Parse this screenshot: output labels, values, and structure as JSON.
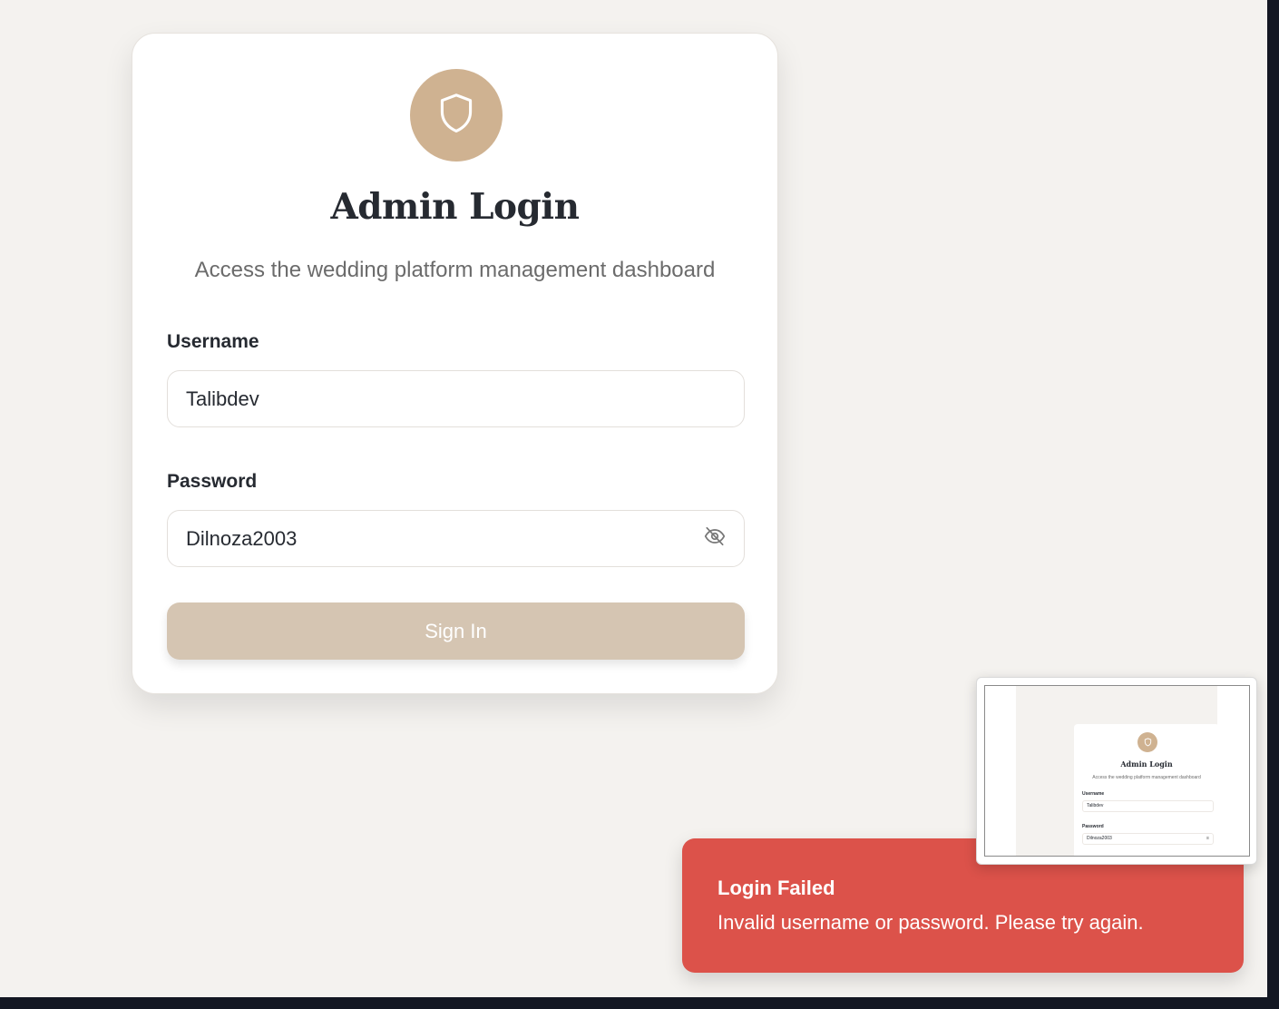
{
  "login": {
    "title": "Admin Login",
    "subtitle": "Access the wedding platform management dashboard",
    "username_label": "Username",
    "username_value": "Talibdev",
    "password_label": "Password",
    "password_value": "Dilnoza2003",
    "signin_label": "Sign In",
    "logo_icon": "shield-icon",
    "toggle_icon": "eye-off-icon"
  },
  "toast": {
    "title": "Login Failed",
    "description": "Invalid username or password. Please try again.",
    "color": "#dc524a"
  },
  "colors": {
    "accent": "#cfb291",
    "button": "#d5c5b2",
    "background": "#f4f2ef"
  }
}
